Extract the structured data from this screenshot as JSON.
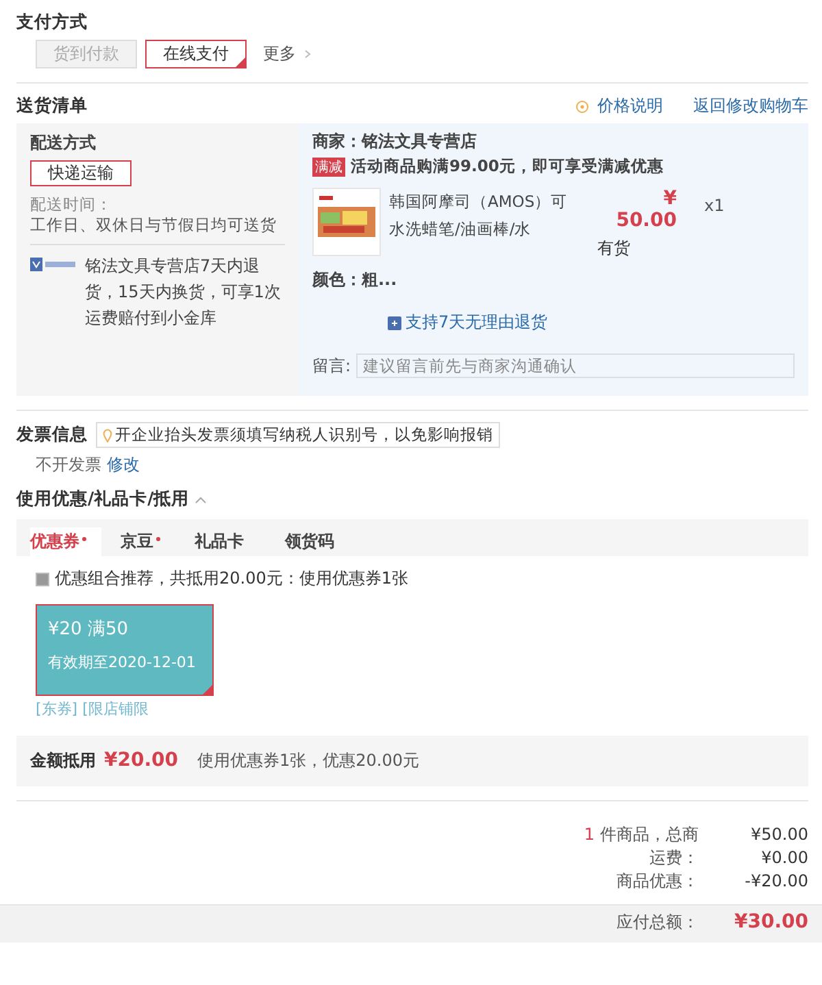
{
  "payment": {
    "title": "支付方式",
    "options": [
      {
        "label": "货到付款",
        "selected": false,
        "disabled": true
      },
      {
        "label": "在线支付",
        "selected": true,
        "disabled": false
      }
    ],
    "more": "更多"
  },
  "delivery": {
    "title": "送货清单",
    "price_note": "价格说明",
    "back_link": "返回修改购物车",
    "shipping": {
      "title": "配送方式",
      "method": {
        "label": "快递运输",
        "selected": true
      },
      "time_label": "配送时间：",
      "time_value": "工作日、双休日与节假日均可送货",
      "guarantee": "铭法文具专营店7天内退货，15天内换货，可享1次运费赔付到小金库"
    },
    "shop": {
      "name": "商家：铭法文具专营店",
      "promo_tag": "满减",
      "promo": "活动商品购满99.00元，即可享受满减优惠",
      "item": {
        "title": "韩国阿摩司（AMOS）可水洗蜡笔/油画棒/水",
        "currency": "¥",
        "price": "50.00",
        "stock": "有货",
        "qty": "x1",
        "variant": "颜色：粗...",
        "return_policy": "支持7天无理由退货"
      },
      "note_label": "留言:",
      "note_placeholder": "建议留言前先与商家沟通确认"
    }
  },
  "invoice": {
    "title": "发票信息",
    "tip": "开企业抬头发票须填写纳税人识别号，以免影响报销",
    "value": "不开发票",
    "edit": "修改"
  },
  "discounts": {
    "title": "使用优惠/礼品卡/抵用",
    "expanded": true,
    "tabs": [
      {
        "label": "优惠券",
        "selected": true,
        "dot": true
      },
      {
        "label": "京豆",
        "selected": false,
        "dot": true
      },
      {
        "label": "礼品卡",
        "selected": false,
        "dot": false
      },
      {
        "label": "领货码",
        "selected": false,
        "dot": false
      }
    ],
    "recommend": {
      "label": "优惠组合推荐，共抵用20.00元：使用优惠券1张",
      "checked": true
    },
    "coupons": [
      {
        "amount": "¥20 满50",
        "validity": "有效期至2020-12-01",
        "tags": "[东券] [限店铺限",
        "selected": true
      }
    ],
    "summary_label": "金额抵用",
    "summary_amount": "¥20.00",
    "summary_text": "使用优惠券1张，优惠20.00元"
  },
  "totals": [
    {
      "count": "1",
      "label": "件商品，总商",
      "value": "¥50.00"
    },
    {
      "label": "运费：",
      "value": "¥0.00"
    },
    {
      "label": "商品优惠：",
      "value": "-¥20.00"
    }
  ],
  "payable": {
    "label": "应付总额：",
    "value": "¥30.00"
  }
}
